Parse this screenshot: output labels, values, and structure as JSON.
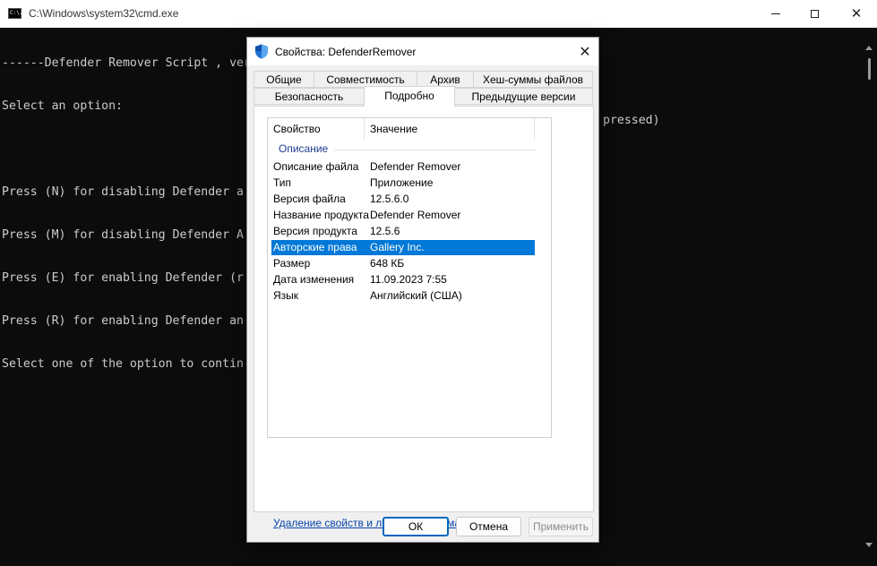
{
  "cmd": {
    "title": "C:\\Windows\\system32\\cmd.exe",
    "icon_name": "console-icon",
    "icon_glyph": "C:\\.",
    "console_lines": [
      "------Defender Remover Script , version 12.5 ------",
      "Select an option:",
      "",
      "Press (N) for disabling Defender a",
      "Press (M) for disabling Defender A",
      "Press (E) for enabling Defender (r",
      "Press (R) for enabling Defender an",
      "Select one of the option to contin"
    ],
    "console_overflow_text": "pressed)",
    "colors": {
      "background": "#0c0c0c",
      "text": "#cccccc"
    }
  },
  "dialog": {
    "title": "Свойства: DefenderRemover",
    "tabs_row1": [
      "Общие",
      "Совместимость",
      "Архив",
      "Хеш-суммы файлов"
    ],
    "tabs_row2": [
      "Безопасность",
      "Подробно",
      "Предыдущие версии"
    ],
    "active_tab": "Подробно",
    "columns": {
      "property": "Свойство",
      "value": "Значение"
    },
    "group": "Описание",
    "rows": [
      {
        "property": "Описание файла",
        "value": "Defender Remover"
      },
      {
        "property": "Тип",
        "value": "Приложение"
      },
      {
        "property": "Версия файла",
        "value": "12.5.6.0"
      },
      {
        "property": "Название продукта",
        "value": "Defender Remover"
      },
      {
        "property": "Версия продукта",
        "value": "12.5.6"
      },
      {
        "property": "Авторские права",
        "value": "Gallery Inc."
      },
      {
        "property": "Размер",
        "value": "648 КБ"
      },
      {
        "property": "Дата изменения",
        "value": "11.09.2023 7:55"
      },
      {
        "property": "Язык",
        "value": "Английский (США)"
      }
    ],
    "selected_row": "Авторские права",
    "remove_link": "Удаление свойств и личной информации",
    "buttons": {
      "ok": "ОК",
      "cancel": "Отмена",
      "apply": "Применить"
    },
    "colors": {
      "selection": "#0078d7",
      "link": "#0645ad",
      "group_label": "#1e3d8f",
      "default_button_border": "#0067c0"
    }
  }
}
